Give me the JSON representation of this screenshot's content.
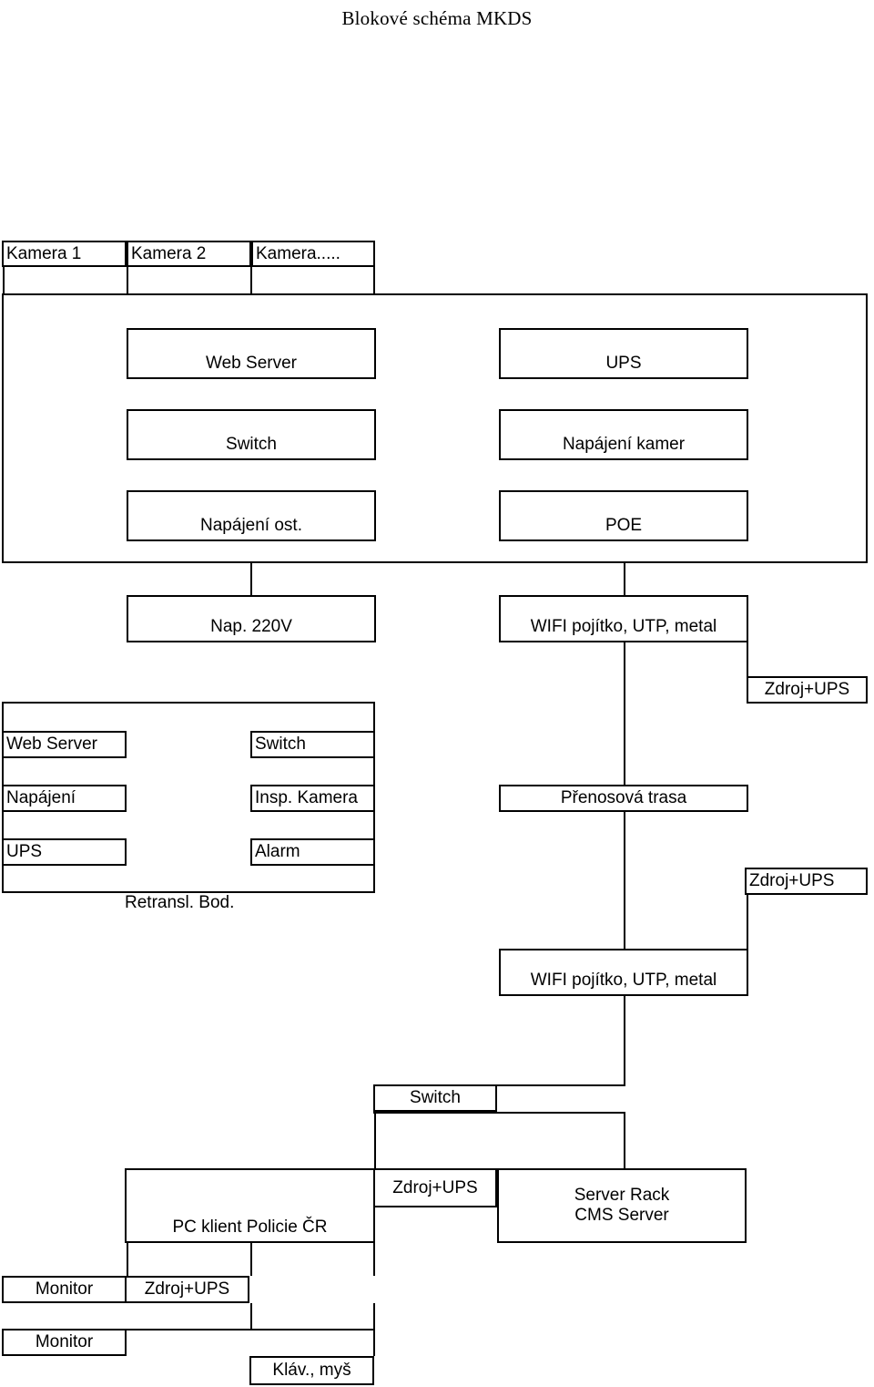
{
  "title": "Blokové schéma MKDS",
  "camera_row": {
    "label": "camera-row",
    "boxes": [
      {
        "label": "Kamera 1"
      },
      {
        "label": "Kamera 2"
      },
      {
        "label": "Kamera....."
      }
    ]
  },
  "camera_site": {
    "label": "camera-site-enclosure",
    "left_column": [
      {
        "label": "Web Server"
      },
      {
        "label": "Switch"
      },
      {
        "label": "Napájení ost."
      }
    ],
    "right_column": [
      {
        "label": "UPS"
      },
      {
        "label": "Napájení kamer"
      },
      {
        "label": "POE"
      }
    ]
  },
  "link_row": {
    "power": {
      "label": "Nap. 220V"
    },
    "link": {
      "label": "WIFI pojítko, UTP, metal"
    },
    "psu": {
      "label": "Zdroj+UPS"
    }
  },
  "retranslation": {
    "caption": "Retransl. Bod.",
    "boxes": [
      {
        "label": "Web Server"
      },
      {
        "label": "Switch"
      },
      {
        "label": "Napájení"
      },
      {
        "label": "Insp. Kamera"
      },
      {
        "label": "UPS"
      },
      {
        "label": "Alarm"
      }
    ]
  },
  "transport": {
    "route": {
      "label": "Přenosová trasa"
    },
    "psu": {
      "label": "Zdroj+UPS"
    },
    "link": {
      "label": "WIFI pojítko, UTP, metal"
    }
  },
  "control_centre": {
    "switch": {
      "label": "Switch"
    },
    "client": {
      "label": "PC klient Policie ČR"
    },
    "client_psu": {
      "label": "Zdroj+UPS"
    },
    "server_rack": {
      "line1": "Server Rack",
      "line2": "CMS Server"
    },
    "monitor_1": {
      "label": "Monitor"
    },
    "monitor_psu": {
      "label": "Zdroj+UPS"
    },
    "monitor_2": {
      "label": "Monitor"
    },
    "peripherals": {
      "label": "Kláv., myš"
    }
  },
  "colors": {
    "stroke": "#000000",
    "background": "#ffffff",
    "text": "#000000"
  }
}
